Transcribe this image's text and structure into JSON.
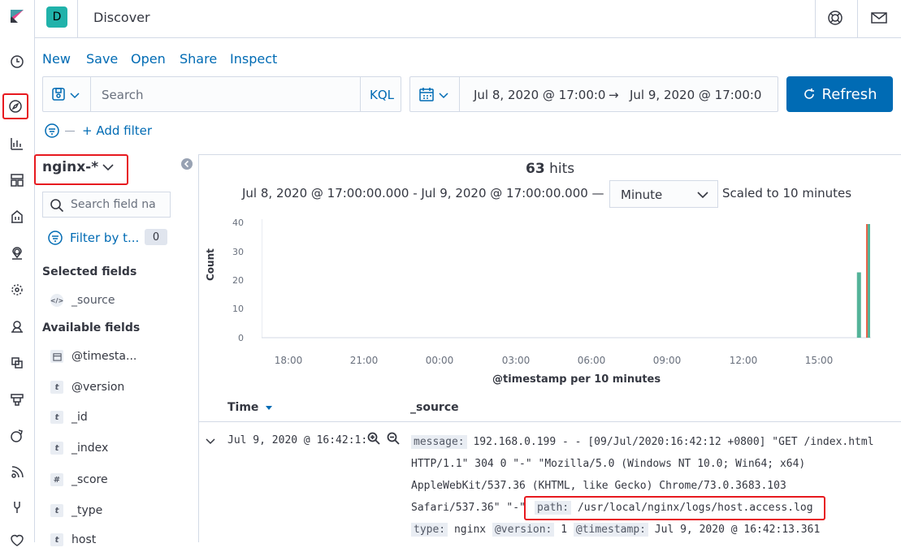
{
  "header": {
    "avatar_letter": "D",
    "title": "Discover"
  },
  "top_menu": [
    "New",
    "Save",
    "Open",
    "Share",
    "Inspect"
  ],
  "query_bar": {
    "placeholder": "Search",
    "language": "KQL"
  },
  "date_range": {
    "start": "Jul 8, 2020 @ 17:00:0",
    "arrow": "→",
    "end": "Jul 9, 2020 @ 17:00:0"
  },
  "refresh_label": "Refresh",
  "add_filter_label": "+ Add filter",
  "sidebar": {
    "index_pattern": "nginx-*",
    "search_placeholder": "Search field na",
    "filter_by_type": "Filter by t...",
    "filter_count": "0",
    "selected_title": "Selected fields",
    "selected_fields": [
      {
        "type": "</>",
        "name": "_source"
      }
    ],
    "available_title": "Available fields",
    "available_fields": [
      {
        "type": "cal",
        "name": "@timesta..."
      },
      {
        "type": "t",
        "name": "@version"
      },
      {
        "type": "t",
        "name": "_id"
      },
      {
        "type": "t",
        "name": "_index"
      },
      {
        "type": "#",
        "name": "_score"
      },
      {
        "type": "t",
        "name": "_type"
      },
      {
        "type": "t",
        "name": "host"
      }
    ]
  },
  "hits": {
    "count": "63",
    "label": "hits"
  },
  "time_range_text": "Jul 8, 2020 @ 17:00:00.000 - Jul 9, 2020 @ 17:00:00.000 —",
  "interval": {
    "selected": "Minute",
    "scaled": "Scaled to 10 minutes"
  },
  "chart_data": {
    "type": "bar",
    "ylabel": "Count",
    "xlabel": "@timestamp per 10 minutes",
    "y_ticks": [
      "0",
      "10",
      "20",
      "30",
      "40"
    ],
    "x_ticks": [
      "18:00",
      "21:00",
      "00:00",
      "03:00",
      "06:00",
      "09:00",
      "12:00",
      "15:00"
    ],
    "x_domain_hours": [
      16.0,
      41.0
    ],
    "ylim": [
      0,
      40
    ],
    "bars": [
      {
        "x": "Jul 9 16:30",
        "value": 23,
        "color": "#54b399"
      },
      {
        "x": "Jul 9 16:40",
        "value": 40,
        "color": "#54b399"
      },
      {
        "x": "Jul 9 16:42",
        "value": 40,
        "color": "#e7664c"
      }
    ],
    "bar_hours": [
      40.5,
      41.0,
      41.2
    ]
  },
  "table": {
    "col_time": "Time",
    "col_source": "_source",
    "row": {
      "time": "Jul 9, 2020 @ 16:42:1:",
      "lines": [
        {
          "k": "message:",
          "v": "192.168.0.199 - - [09/Jul/2020:16:42:12 +0800] \"GET /index.html"
        },
        {
          "k": "",
          "v": "HTTP/1.1\" 304 0 \"-\" \"Mozilla/5.0 (Windows NT 10.0; Win64; x64)"
        },
        {
          "k": "",
          "v": "AppleWebKit/537.36 (KHTML, like Gecko) Chrome/73.0.3683.103"
        },
        {
          "k": "",
          "v": "Safari/537.36\" \"-\""
        }
      ],
      "path_key": "path:",
      "path_val": "/usr/local/nginx/logs/host.access.log",
      "type_key": "type:",
      "type_val": "nginx",
      "version_key": "@version:",
      "version_val": "1",
      "ts_key": "@timestamp:",
      "ts_val": "Jul 9, 2020 @ 16:42:13.361"
    }
  }
}
